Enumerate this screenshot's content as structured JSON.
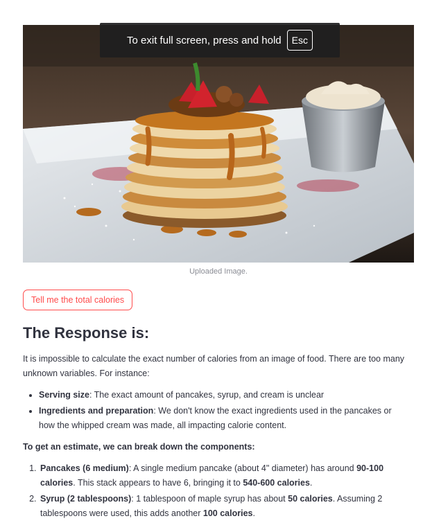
{
  "fullscreen_notice": {
    "text": "To exit full screen, press and hold",
    "key": "Esc"
  },
  "image": {
    "caption": "Uploaded Image."
  },
  "action_button": "Tell me the total calories",
  "response": {
    "title": "The Response is:",
    "intro": "It is impossible to calculate the exact number of calories from an image of food. There are too many unknown variables. For instance:",
    "bullets": [
      {
        "term": "Serving size",
        "text": ": The exact amount of pancakes, syrup, and cream is unclear"
      },
      {
        "term": "Ingredients and preparation",
        "text": ": We don't know the exact ingredients used in the pancakes or how the whipped cream was made, all impacting calorie content."
      }
    ],
    "estimate_heading": "To get an estimate, we can break down the components:",
    "steps": [
      {
        "term": "Pancakes (6 medium)",
        "t1": ": A single medium pancake (about 4\" diameter) has around ",
        "b1": "90-100 calories",
        "t2": ". This stack appears to have 6, bringing it to ",
        "b2": "540-600 calories",
        "t3": "."
      },
      {
        "term": "Syrup (2 tablespoons)",
        "t1": ": 1 tablespoon of maple syrup has about ",
        "b1": "50 calories",
        "t2": ". Assuming 2 tablespoons were used, this adds another ",
        "b2": "100 calories",
        "t3": "."
      }
    ]
  }
}
